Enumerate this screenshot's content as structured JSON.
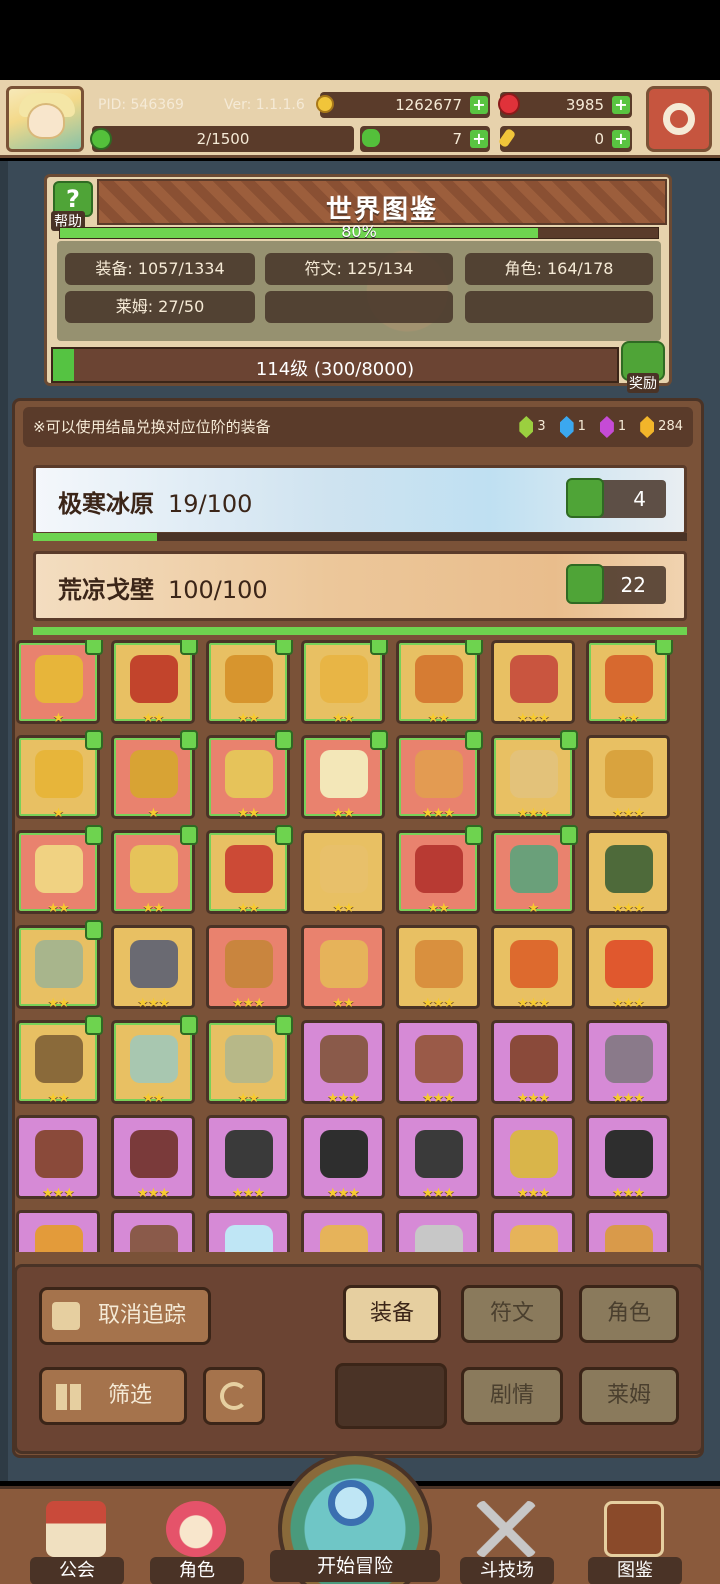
{
  "top": {
    "pid": "PID: 546369",
    "version": "Ver: 1.1.1.6",
    "gold": "1262677",
    "ruby": "3985",
    "stamina": "2/1500",
    "clover": "7",
    "key": "0",
    "colors": {
      "gold": "#f1c53a",
      "ruby": "#e0323a",
      "clover": "#54c03b"
    }
  },
  "world": {
    "help_label": "帮助",
    "title": "世界图鉴",
    "progress_text": "80%",
    "progress_percent": 80,
    "stats": {
      "equipment": "装备: 1057/1334",
      "runes": "符文: 125/134",
      "characters": "角色: 164/178",
      "slime": "莱姆: 27/50"
    },
    "level_text": "114级 (300/8000)",
    "level_fraction": 0.0375,
    "reward_label": "奖励"
  },
  "collection": {
    "notice": "※可以使用结晶兑换对应位阶的装备",
    "crystals": [
      {
        "color": "#9bcf3f",
        "count": "3"
      },
      {
        "color": "#3ba8f0",
        "count": "1"
      },
      {
        "color": "#c54bd6",
        "count": "1"
      },
      {
        "color": "#f2b52a",
        "count": "284"
      }
    ],
    "regions": [
      {
        "name": "极寒冰原",
        "count": "19/100",
        "likes": "4",
        "progress": 0.19
      },
      {
        "name": "荒凉戈壁",
        "count": "100/100",
        "likes": "22",
        "progress": 1.0
      }
    ],
    "items": [
      {
        "bg": "#e9826e",
        "art": "#e7b53a",
        "stars": "★",
        "tracked": true,
        "icon": "heart-necklace-icon"
      },
      {
        "bg": "#e8c063",
        "art": "#c2442c",
        "stars": "★★",
        "tracked": true,
        "icon": "glove-icon"
      },
      {
        "bg": "#e8c063",
        "art": "#d7952e",
        "stars": "★★",
        "tracked": true,
        "icon": "ring-icon"
      },
      {
        "bg": "#e8c063",
        "art": "#e8b545",
        "stars": "★★",
        "tracked": true,
        "icon": "necklace-icon"
      },
      {
        "bg": "#e8c063",
        "art": "#d67c33",
        "stars": "★★",
        "tracked": true,
        "icon": "scepter-icon"
      },
      {
        "bg": "#e8c063",
        "art": "#c9553f",
        "stars": "★★★",
        "tracked": false,
        "icon": "armor-icon"
      },
      {
        "bg": "#e8c063",
        "art": "#d7692f",
        "stars": "★★",
        "tracked": true,
        "icon": "chest-armor-icon"
      },
      {
        "bg": "#e8c063",
        "art": "#e7b53a",
        "stars": "★",
        "tracked": true,
        "icon": "mace-icon"
      },
      {
        "bg": "#e9826e",
        "art": "#d8a334",
        "stars": "★",
        "tracked": true,
        "icon": "crown-ring-icon"
      },
      {
        "bg": "#e9826e",
        "art": "#e6c35a",
        "stars": "★★",
        "tracked": true,
        "icon": "golden-armor-icon"
      },
      {
        "bg": "#e9826e",
        "art": "#f3e7b8",
        "stars": "★★",
        "tracked": true,
        "icon": "holy-cross-icon"
      },
      {
        "bg": "#e9826e",
        "art": "#e39b52",
        "stars": "★★★",
        "tracked": true,
        "icon": "pendant-icon"
      },
      {
        "bg": "#e8c063",
        "art": "#e3c27a",
        "stars": "★★★",
        "tracked": true,
        "icon": "helmet-icon"
      },
      {
        "bg": "#e8c063",
        "art": "#d9a33e",
        "stars": "★★★",
        "tracked": false,
        "icon": "greaves-icon"
      },
      {
        "bg": "#e9826e",
        "art": "#f0d282",
        "stars": "★★",
        "tracked": true,
        "icon": "gauntlet-icon"
      },
      {
        "bg": "#e9826e",
        "art": "#e6c35a",
        "stars": "★★",
        "tracked": true,
        "icon": "gold-gauntlet-icon"
      },
      {
        "bg": "#e8c063",
        "art": "#cc4a36",
        "stars": "★★",
        "tracked": true,
        "icon": "ruby-necklace-icon"
      },
      {
        "bg": "#e8c063",
        "art": "#e8c06a",
        "stars": "★★",
        "tracked": false,
        "icon": "gear-ring-icon"
      },
      {
        "bg": "#e9826e",
        "art": "#b83a33",
        "stars": "★★",
        "tracked": true,
        "icon": "red-ring-icon"
      },
      {
        "bg": "#e9826e",
        "art": "#6aa07a",
        "stars": "★",
        "tracked": true,
        "icon": "sword-icon"
      },
      {
        "bg": "#e8c063",
        "art": "#4e6a3a",
        "stars": "★★★",
        "tracked": false,
        "icon": "hood-icon"
      },
      {
        "bg": "#e8c063",
        "art": "#a8b58c",
        "stars": "★★",
        "tracked": true,
        "icon": "horn-icon"
      },
      {
        "bg": "#e8c063",
        "art": "#6a6a72",
        "stars": "★★★",
        "tracked": false,
        "icon": "dagger-icon"
      },
      {
        "bg": "#e9826e",
        "art": "#c9853e",
        "stars": "★★★",
        "tracked": false,
        "icon": "gem-ring-icon"
      },
      {
        "bg": "#e9826e",
        "art": "#e6b35a",
        "stars": "★★",
        "tracked": false,
        "icon": "flower-icon"
      },
      {
        "bg": "#e8c063",
        "art": "#d9903e",
        "stars": "★★★",
        "tracked": false,
        "icon": "spear-icon"
      },
      {
        "bg": "#e8c063",
        "art": "#dd6a2e",
        "stars": "★★★",
        "tracked": false,
        "icon": "amulet-icon"
      },
      {
        "bg": "#e8c063",
        "art": "#e0582e",
        "stars": "★★★",
        "tracked": false,
        "icon": "ruby-ring-icon"
      },
      {
        "bg": "#e8c063",
        "art": "#8a6a3a",
        "stars": "★★",
        "tracked": true,
        "icon": "crossbow-icon"
      },
      {
        "bg": "#e8c063",
        "art": "#a8c7b0",
        "stars": "★★",
        "tracked": true,
        "icon": "jade-armor-icon"
      },
      {
        "bg": "#e8c063",
        "art": "#b7b888",
        "stars": "★★",
        "tracked": true,
        "icon": "boots-icon"
      },
      {
        "bg": "#d68ad6",
        "art": "#8a5a4a",
        "stars": "★★★",
        "tracked": false,
        "icon": "brown-necklace-icon"
      },
      {
        "bg": "#d68ad6",
        "art": "#9a5a48",
        "stars": "★★★",
        "tracked": false,
        "icon": "leather-armor-icon"
      },
      {
        "bg": "#d68ad6",
        "art": "#8a4a3a",
        "stars": "★★★",
        "tracked": false,
        "icon": "leather-boots-icon"
      },
      {
        "bg": "#d68ad6",
        "art": "#8a7a8a",
        "stars": "★★★",
        "tracked": false,
        "icon": "gun-icon"
      },
      {
        "bg": "#d68ad6",
        "art": "#8a4a3a",
        "stars": "★★★",
        "tracked": false,
        "icon": "axe-icon"
      },
      {
        "bg": "#d68ad6",
        "art": "#7a3a3a",
        "stars": "★★★",
        "tracked": false,
        "icon": "belt-icon"
      },
      {
        "bg": "#d68ad6",
        "art": "#3a3a3a",
        "stars": "★★★",
        "tracked": false,
        "icon": "dark-helmet-icon"
      },
      {
        "bg": "#d68ad6",
        "art": "#2e2e2e",
        "stars": "★★★",
        "tracked": false,
        "icon": "dark-armor-icon"
      },
      {
        "bg": "#d68ad6",
        "art": "#3a3a3a",
        "stars": "★★★",
        "tracked": false,
        "icon": "dark-gauntlet-icon"
      },
      {
        "bg": "#d68ad6",
        "art": "#d9b54a",
        "stars": "★★★",
        "tracked": false,
        "icon": "gold-emblem-icon"
      },
      {
        "bg": "#d68ad6",
        "art": "#2e2e2e",
        "stars": "★★★",
        "tracked": false,
        "icon": "dark-necklace-icon"
      },
      {
        "bg": "#d68ad6",
        "art": "#e39b3a",
        "stars": "",
        "tracked": false,
        "icon": "item-icon"
      },
      {
        "bg": "#d68ad6",
        "art": "#8a5a4a",
        "stars": "",
        "tracked": false,
        "icon": "item-icon"
      },
      {
        "bg": "#d68ad6",
        "art": "#bfe6f5",
        "stars": "",
        "tracked": false,
        "icon": "item-icon"
      },
      {
        "bg": "#d68ad6",
        "art": "#e6b35a",
        "stars": "",
        "tracked": false,
        "icon": "item-icon"
      },
      {
        "bg": "#d68ad6",
        "art": "#c7c7c7",
        "stars": "",
        "tracked": false,
        "icon": "item-icon"
      },
      {
        "bg": "#d68ad6",
        "art": "#e6b35a",
        "stars": "",
        "tracked": false,
        "icon": "item-icon"
      },
      {
        "bg": "#d68ad6",
        "art": "#d99a4a",
        "stars": "",
        "tracked": false,
        "icon": "item-icon"
      }
    ]
  },
  "controls": {
    "untrack": "取消追踪",
    "equipment": "装备",
    "runes": "符文",
    "characters": "角色",
    "filter": "筛选",
    "story": "剧情",
    "slime": "莱姆"
  },
  "nav": {
    "guild": "公会",
    "character": "角色",
    "adventure": "开始冒险",
    "arena": "斗技场",
    "codex": "图鉴"
  }
}
